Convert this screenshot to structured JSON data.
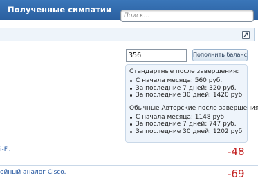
{
  "header": {
    "title": "Полученные симпатии",
    "search_placeholder": "Поиск..."
  },
  "topup": {
    "amount_value": "356",
    "button_label": "Пополнить баланс"
  },
  "stats": {
    "standard": {
      "heading": "Стандартные после завершения:",
      "items": [
        "С начала месяца: 560 руб.",
        "За последние 7 дней: 320 руб.",
        "За последние 30 дней: 1420 руб."
      ]
    },
    "author": {
      "heading": "Обычные Авторские после завершения:",
      "items": [
        "С начала месяца: 1148 руб.",
        "За последние 7 дней: 747 руб.",
        "За последние 30 дней: 1202 руб."
      ]
    }
  },
  "entries": [
    {
      "link": "i-Fi.",
      "score": "-48"
    },
    {
      "link": "ойный аналог Cisco.",
      "score": "-69"
    }
  ],
  "colors": {
    "header_bg": "#2f69ab",
    "score": "#c32222",
    "link": "#2456a0",
    "panel_bg": "#eef4fb"
  },
  "icons": {
    "expand": "external-link-icon"
  }
}
